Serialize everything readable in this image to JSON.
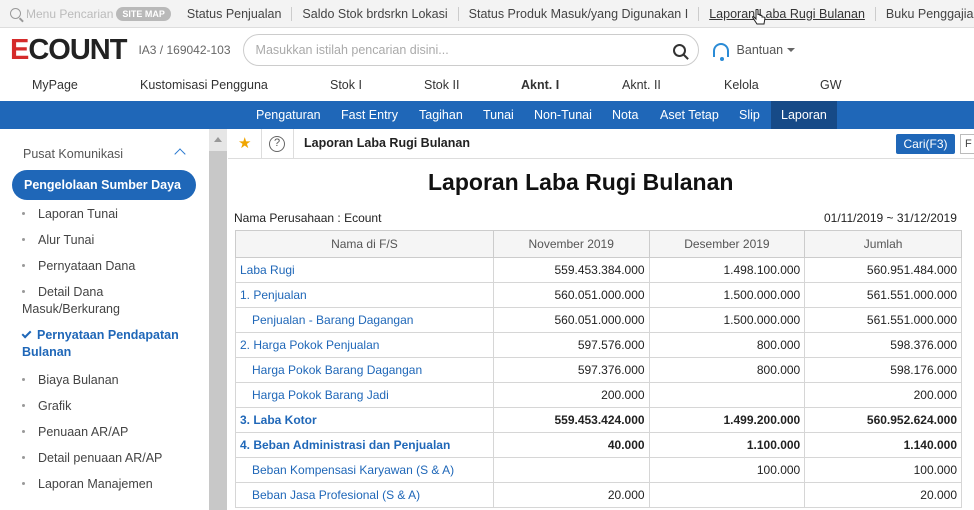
{
  "topbar": {
    "search_placeholder": "Menu Pencarian",
    "sitemap_label": "SITE MAP",
    "links": [
      {
        "label": "Status Penjualan",
        "active": false
      },
      {
        "label": "Saldo Stok brdsrkn Lokasi",
        "active": false
      },
      {
        "label": "Status Produk Masuk/yang Digunakan I",
        "active": false
      },
      {
        "label": "Laporan Laba Rugi Bulanan",
        "active": true
      },
      {
        "label": "Buku Penggajian",
        "active": false
      }
    ]
  },
  "header": {
    "logo_e": "E",
    "logo_rest": "COUNT",
    "company_id": "IA3 / 169042-103",
    "search_placeholder": "Masukkan istilah pencarian disini...",
    "help_label": "Bantuan"
  },
  "mainnav": [
    {
      "label": "MyPage",
      "active": false
    },
    {
      "label": "Kustomisasi Pengguna",
      "active": false
    },
    {
      "label": "Stok I",
      "active": false
    },
    {
      "label": "Stok II",
      "active": false
    },
    {
      "label": "Aknt. I",
      "active": true
    },
    {
      "label": "Aknt. II",
      "active": false
    },
    {
      "label": "Kelola",
      "active": false
    },
    {
      "label": "GW",
      "active": false
    }
  ],
  "subnav": [
    {
      "label": "Pengaturan",
      "active": false
    },
    {
      "label": "Fast Entry",
      "active": false
    },
    {
      "label": "Tagihan",
      "active": false
    },
    {
      "label": "Tunai",
      "active": false
    },
    {
      "label": "Non-Tunai",
      "active": false
    },
    {
      "label": "Nota",
      "active": false
    },
    {
      "label": "Aset Tetap",
      "active": false
    },
    {
      "label": "Slip",
      "active": false
    },
    {
      "label": "Laporan",
      "active": true
    }
  ],
  "sidebar": {
    "title": "Pusat Komunikasi",
    "group_label": "Pengelolaan Sumber Daya",
    "items": [
      {
        "label": "Laporan Tunai"
      },
      {
        "label": "Alur Tunai"
      },
      {
        "label": "Pernyataan Dana"
      },
      {
        "label": "Detail Dana Masuk/Berkurang"
      },
      {
        "label": "Pernyataan Pendapatan Bulanan",
        "selected": true
      },
      {
        "label": "Biaya Bulanan"
      },
      {
        "label": "Grafik"
      },
      {
        "label": "Penuaan AR/AP"
      },
      {
        "label": "Detail penuaan AR/AP"
      },
      {
        "label": "Laporan Manajemen"
      }
    ]
  },
  "content": {
    "toolbar_title": "Laporan Laba Rugi Bulanan",
    "search_button": "Cari(F3)",
    "extra_button": "F",
    "report_title": "Laporan Laba Rugi Bulanan",
    "company_label": "Nama Perusahaan : Ecount",
    "period": "01/11/2019 ~ 31/12/2019",
    "columns": [
      "Nama di F/S",
      "November 2019",
      "Desember 2019",
      "Jumlah"
    ],
    "rows": [
      {
        "name": "Laba Rugi",
        "nov": "559.453.384.000",
        "des": "1.498.100.000",
        "total": "560.951.484.000",
        "indent": false,
        "bold": false
      },
      {
        "name": "1. Penjualan",
        "nov": "560.051.000.000",
        "des": "1.500.000.000",
        "total": "561.551.000.000",
        "indent": false,
        "bold": false
      },
      {
        "name": "Penjualan - Barang Dagangan",
        "nov": "560.051.000.000",
        "des": "1.500.000.000",
        "total": "561.551.000.000",
        "indent": true,
        "bold": false
      },
      {
        "name": "2. Harga Pokok Penjualan",
        "nov": "597.576.000",
        "des": "800.000",
        "total": "598.376.000",
        "indent": false,
        "bold": false
      },
      {
        "name": "Harga Pokok Barang Dagangan",
        "nov": "597.376.000",
        "des": "800.000",
        "total": "598.176.000",
        "indent": true,
        "bold": false
      },
      {
        "name": "Harga Pokok Barang Jadi",
        "nov": "200.000",
        "des": "",
        "total": "200.000",
        "indent": true,
        "bold": false
      },
      {
        "name": "3. Laba Kotor",
        "nov": "559.453.424.000",
        "des": "1.499.200.000",
        "total": "560.952.624.000",
        "indent": false,
        "bold": true
      },
      {
        "name": "4. Beban Administrasi dan Penjualan",
        "nov": "40.000",
        "des": "1.100.000",
        "total": "1.140.000",
        "indent": false,
        "bold": true
      },
      {
        "name": "Beban Kompensasi Karyawan (S & A)",
        "nov": "",
        "des": "100.000",
        "total": "100.000",
        "indent": true,
        "bold": false
      },
      {
        "name": "Beban Jasa Profesional (S & A)",
        "nov": "20.000",
        "des": "",
        "total": "20.000",
        "indent": true,
        "bold": false
      }
    ]
  }
}
